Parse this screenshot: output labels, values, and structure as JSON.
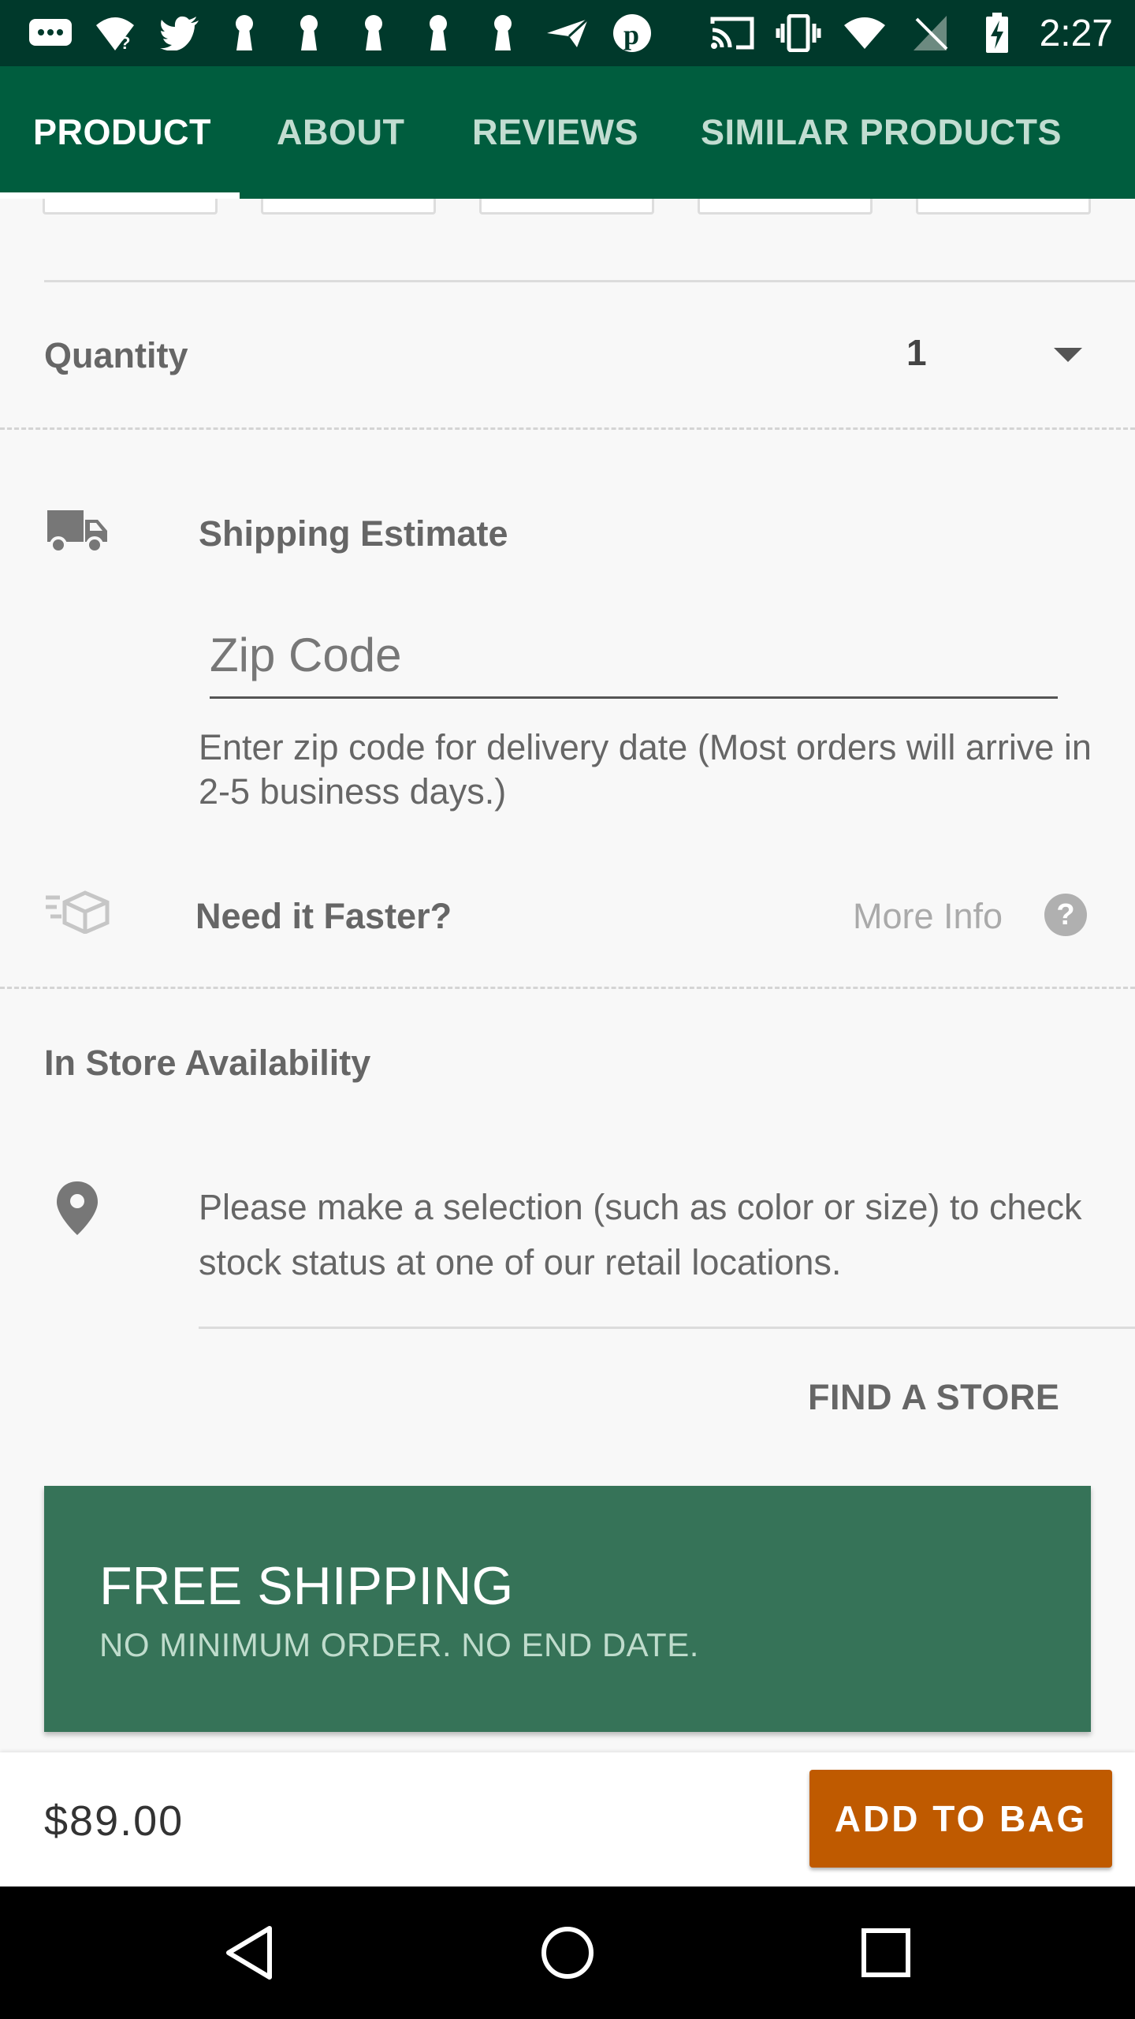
{
  "status_bar": {
    "time": "2:27",
    "left_icons": [
      "messages-icon",
      "wifi-question-icon",
      "twitter-icon",
      "keyhole-icon",
      "keyhole-icon",
      "keyhole-icon",
      "keyhole-icon",
      "keyhole-icon",
      "send-icon",
      "pinterest-icon"
    ],
    "right_icons": [
      "cast-icon",
      "vibrate-icon",
      "wifi-icon",
      "no-signal-icon",
      "battery-charging-icon"
    ]
  },
  "tabs": [
    {
      "label": "PRODUCT",
      "active": true
    },
    {
      "label": "ABOUT",
      "active": false
    },
    {
      "label": "REVIEWS",
      "active": false
    },
    {
      "label": "SIMILAR PRODUCTS",
      "active": false
    }
  ],
  "quantity": {
    "label": "Quantity",
    "value": "1"
  },
  "shipping": {
    "title": "Shipping Estimate",
    "zip_placeholder": "Zip Code",
    "helper": "Enter zip code for delivery date (Most orders will arrive in 2-5 business days.)"
  },
  "faster": {
    "label": "Need it Faster?",
    "more_info": "More Info",
    "help_glyph": "?"
  },
  "store": {
    "title": "In Store Availability",
    "message": "Please make a selection (such as color or size) to check stock status at one of our retail locations.",
    "find_button": "FIND A STORE"
  },
  "promo": {
    "title": "FREE SHIPPING",
    "subtitle": "NO MINIMUM ORDER. NO END DATE."
  },
  "purchase": {
    "price": "$89.00",
    "add_button": "ADD TO BAG"
  },
  "colors": {
    "status_bar": "#00392b",
    "tab_bar": "#005d3e",
    "promo_bg": "#367358",
    "add_button": "#bf5a00"
  }
}
